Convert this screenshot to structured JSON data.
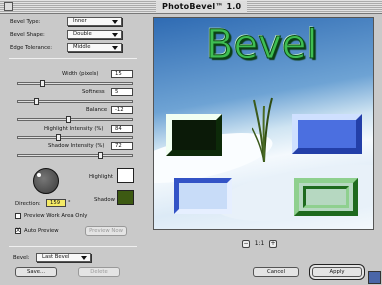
{
  "app": {
    "title": "PhotoBevel™ 1.0"
  },
  "controls": {
    "bevel_type": {
      "label": "Bevel Type:",
      "value": "Inner"
    },
    "bevel_shape": {
      "label": "Bevel Shape:",
      "value": "Double"
    },
    "edge_tolerance": {
      "label": "Edge Tolerance:",
      "value": "Middle"
    },
    "width": {
      "label": "Width (pixels)",
      "value": "15",
      "level": 0.2
    },
    "softness": {
      "label": "Softness",
      "value": "5",
      "level": 0.15
    },
    "balance": {
      "label": "Balance",
      "value": "-12",
      "level": 0.44
    },
    "highlight_intensity": {
      "label": "Highlight Intensity (%)",
      "value": "84",
      "level": 0.35
    },
    "shadow_intensity": {
      "label": "Shadow Intensity (%)",
      "value": "72",
      "level": 0.73
    }
  },
  "swatches": {
    "highlight": {
      "label": "Highlight",
      "color": "#ffffff"
    },
    "shadow": {
      "label": "Shadow",
      "color": "#3d5a12"
    }
  },
  "direction": {
    "label": "Direction:",
    "value": "159",
    "unit": "°"
  },
  "options": {
    "preview_work_area": {
      "label": "Preview Work Area Only",
      "checked": false
    },
    "auto_preview": {
      "label": "Auto Preview",
      "checked": true,
      "mark": "X"
    }
  },
  "buttons": {
    "preview_now": "Preview Now",
    "save": "Save...",
    "delete": "Delete",
    "cancel": "Cancel",
    "apply": "Apply"
  },
  "bevel_preset": {
    "label": "Bevel:",
    "value": "Last Bevel"
  },
  "preview": {
    "headline": "Bevel",
    "zoom": "1:1",
    "zoom_out": "−",
    "zoom_in": "+"
  },
  "colors": {
    "accent_green": "#3fbe52",
    "sky_blue": "#2f6bb3"
  }
}
